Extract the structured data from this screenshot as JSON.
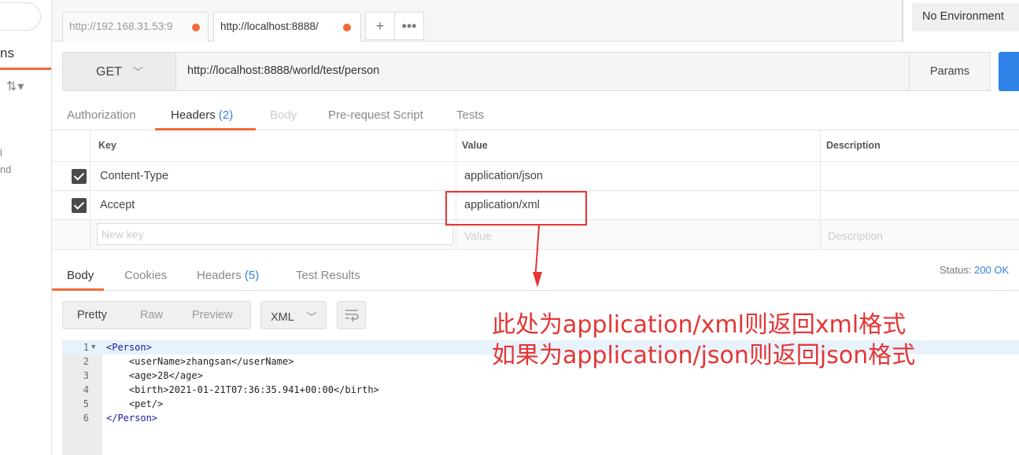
{
  "sidebar": {
    "tab_fragment": "ns",
    "sort_icon": "sort-icon",
    "text1": "l",
    "text2": "nd"
  },
  "tabs": [
    {
      "label": "http://192.168.31.53:9"
    },
    {
      "label": "http://localhost:8888/"
    }
  ],
  "environment": "No Environment",
  "request": {
    "method": "GET",
    "url": "http://localhost:8888/world/test/person",
    "params_label": "Params"
  },
  "request_tabs": {
    "authorization": "Authorization",
    "headers": "Headers",
    "headers_count": "(2)",
    "body": "Body",
    "prerequest": "Pre-request Script",
    "tests": "Tests"
  },
  "headers_table": {
    "columns": {
      "key": "Key",
      "value": "Value",
      "description": "Description"
    },
    "rows": [
      {
        "key": "Content-Type",
        "value": "application/json"
      },
      {
        "key": "Accept",
        "value": "application/xml"
      }
    ],
    "placeholders": {
      "key": "New key",
      "value": "Value",
      "description": "Description"
    }
  },
  "response_tabs": {
    "body": "Body",
    "cookies": "Cookies",
    "headers": "Headers",
    "headers_count": "(5)",
    "test_results": "Test Results"
  },
  "status": {
    "label": "Status:",
    "value": "200 OK"
  },
  "body_view": {
    "pretty": "Pretty",
    "raw": "Raw",
    "preview": "Preview",
    "format": "XML"
  },
  "code_lines": [
    "<Person>",
    "    <userName>zhangsan</userName>",
    "    <age>28</age>",
    "    <birth>2021-01-21T07:36:35.941+00:00</birth>",
    "    <pet/>",
    "</Person>"
  ],
  "annotation": {
    "line1": "此处为application/xml则返回xml格式",
    "line2": "如果为application/json则返回json格式",
    "color": "#e53535"
  },
  "colors": {
    "accent": "#f26b3a",
    "link": "#2f83e8"
  }
}
